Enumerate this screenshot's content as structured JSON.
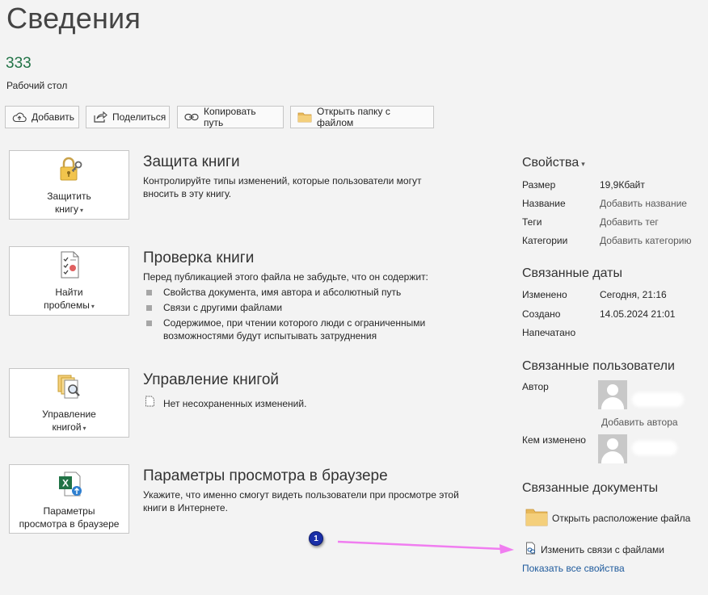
{
  "page": {
    "title": "Сведения"
  },
  "file": {
    "name": "333",
    "location": "Рабочий стол"
  },
  "actions": [
    {
      "label": "Добавить",
      "icon": "cloud-upload-icon"
    },
    {
      "label": "Поделиться",
      "icon": "share-icon"
    },
    {
      "label": "Копировать путь",
      "icon": "link-icon"
    },
    {
      "label": "Открыть папку с файлом",
      "icon": "folder-icon"
    }
  ],
  "sections": {
    "protect": {
      "button_line1": "Защитить",
      "button_line2": "книгу",
      "title": "Защита книги",
      "desc": "Контролируйте типы изменений, которые пользователи могут вносить в эту книгу."
    },
    "inspect": {
      "button_line1": "Найти",
      "button_line2": "проблемы",
      "title": "Проверка книги",
      "desc": "Перед публикацией этого файла не забудьте, что он содержит:",
      "bullets": [
        "Свойства документа, имя автора и абсолютный путь",
        "Связи с другими файлами",
        "Содержимое, при чтении которого люди с ограниченными возможностями будут испытывать затруднения"
      ]
    },
    "manage": {
      "button_line1": "Управление",
      "button_line2": "книгой",
      "title": "Управление книгой",
      "item": "Нет несохраненных изменений."
    },
    "browser": {
      "button_line1": "Параметры",
      "button_line2": "просмотра в браузере",
      "title": "Параметры просмотра в браузере",
      "desc": "Укажите, что именно смогут видеть пользователи при просмотре этой книги в Интернете."
    }
  },
  "properties": {
    "heading": "Свойства",
    "size_label": "Размер",
    "size_value": "19,9Кбайт",
    "title_label": "Название",
    "title_placeholder": "Добавить название",
    "tags_label": "Теги",
    "tags_placeholder": "Добавить тег",
    "category_label": "Категории",
    "category_placeholder": "Добавить категорию"
  },
  "dates": {
    "heading": "Связанные даты",
    "modified_label": "Изменено",
    "modified_value": "Сегодня, 21:16",
    "created_label": "Создано",
    "created_value": "14.05.2024 21:01",
    "printed_label": "Напечатано"
  },
  "people": {
    "heading": "Связанные пользователи",
    "author_label": "Автор",
    "add_author": "Добавить автора",
    "modified_by_label": "Кем изменено"
  },
  "documents": {
    "heading": "Связанные документы",
    "open_location": "Открыть расположение файла",
    "edit_links": "Изменить связи с файлами"
  },
  "show_all": "Показать все свойства",
  "annotation": {
    "number": "1"
  },
  "colors": {
    "accent_green": "#217346",
    "link_blue": "#1e5a9c",
    "arrow_pink": "#f07df0",
    "badge_blue": "#1a2fa8"
  }
}
